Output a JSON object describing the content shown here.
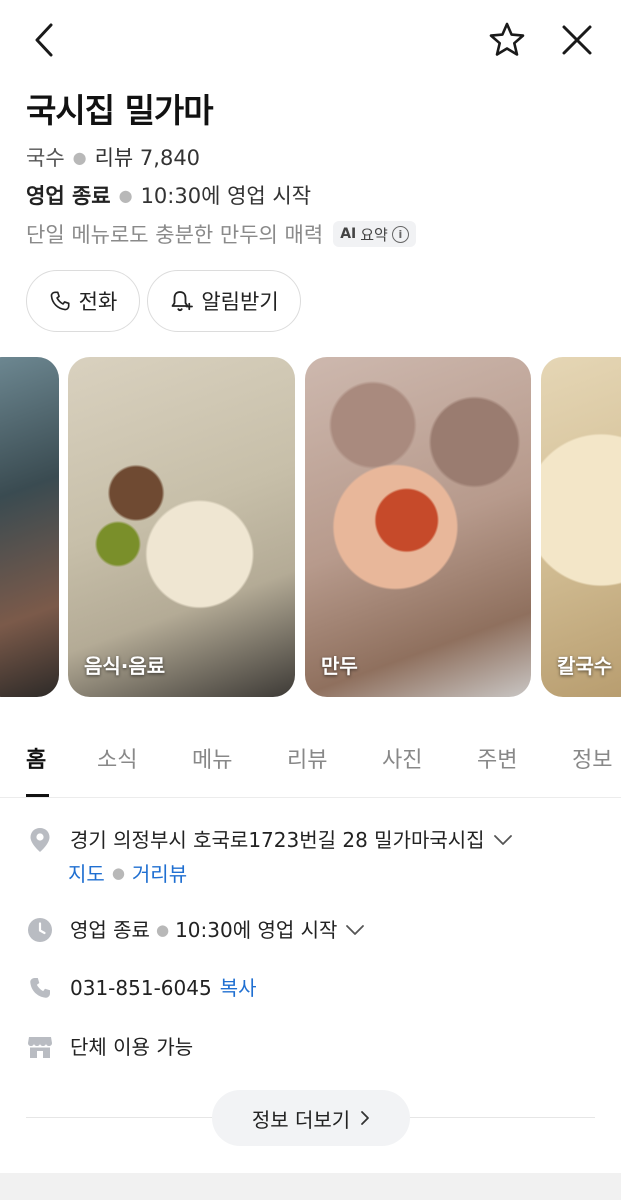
{
  "header": {
    "back_icon": "chevron-left-icon",
    "favorite_icon": "star-outline-icon",
    "close_icon": "close-icon"
  },
  "place": {
    "name": "국시집 밀가마",
    "category": "국수",
    "review_label": "리뷰 7,840",
    "status": "영업 종료",
    "open_info": "10:30에 영업 시작",
    "summary": "단일 메뉴로도 충분한 만두의 매력",
    "ai_badge": {
      "ai": "AI",
      "label": "요약",
      "info_icon": "i"
    }
  },
  "actions": {
    "call_label": "전화",
    "notify_label": "알림받기"
  },
  "photos": [
    {
      "caption": ""
    },
    {
      "caption": "음식·음료"
    },
    {
      "caption": "만두"
    },
    {
      "caption": "칼국수"
    }
  ],
  "tabs": [
    {
      "label": "홈",
      "active": true
    },
    {
      "label": "소식",
      "active": false
    },
    {
      "label": "메뉴",
      "active": false
    },
    {
      "label": "리뷰",
      "active": false
    },
    {
      "label": "사진",
      "active": false
    },
    {
      "label": "주변",
      "active": false
    },
    {
      "label": "정보",
      "active": false
    }
  ],
  "details": {
    "address": "경기 의정부시 호국로1723번길 28 밀가마국시집",
    "map_link": "지도",
    "street_view_link": "거리뷰",
    "hours_status": "영업 종료",
    "hours_info": "10:30에 영업 시작",
    "phone": "031-851-6045",
    "copy_label": "복사",
    "group_info": "단체 이용 가능"
  },
  "more": {
    "label": "정보 더보기"
  },
  "colors": {
    "link": "#1f6fd1",
    "text": "#1e1e1e",
    "muted": "#8a8a8a",
    "icon_gray": "#b9bcc2"
  }
}
